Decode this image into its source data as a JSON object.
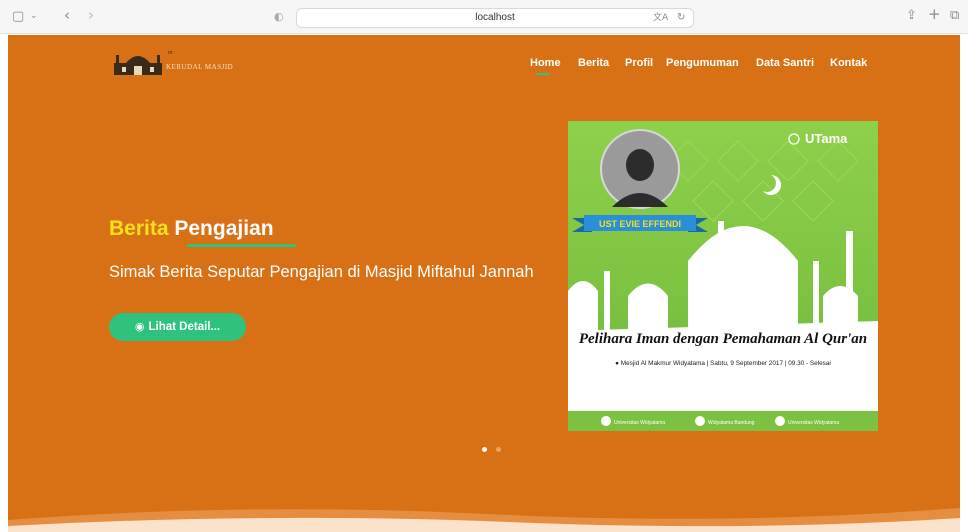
{
  "browser": {
    "url": "localhost",
    "icons": [
      "sidebar-icon",
      "chevron-down-icon",
      "back-icon",
      "forward-icon",
      "privacy-icon",
      "translate-icon",
      "reload-icon",
      "share-icon",
      "new-tab-icon",
      "tabs-icon"
    ]
  },
  "site": {
    "logo_text": "KERUDAL MASJID",
    "logo_small": "ᵐ",
    "nav": [
      "Home",
      "Berita",
      "Profil",
      "Pengumuman",
      "Data Santri",
      "Kontak"
    ],
    "active_nav": "Home"
  },
  "hero": {
    "title_word1": "Berita",
    "title_word2": "Pengajian",
    "subtitle": "Simak Berita Seputar Pengajian di Masjid Miftahul Jannah",
    "button_label": "Lihat Detail...",
    "slides": 2,
    "active_slide": 1
  },
  "poster": {
    "brand": "UTama",
    "speaker": "UST EVIE EFFENDI",
    "title": "Pelihara Iman dengan Pemahaman Al Qur'an",
    "details": "Mesjid Al Makmur Widyatama | Sabtu, 9 September 2017 | 09.30 - Selesai",
    "footer": [
      "Universitas Widyatama",
      "Widyatama Bandung",
      "Universitas Widyatama"
    ]
  },
  "colors": {
    "primary": "#d87115",
    "accent_green": "#2ec27e",
    "title_yellow": "#f7e01b",
    "poster_green": "#7cc242"
  }
}
